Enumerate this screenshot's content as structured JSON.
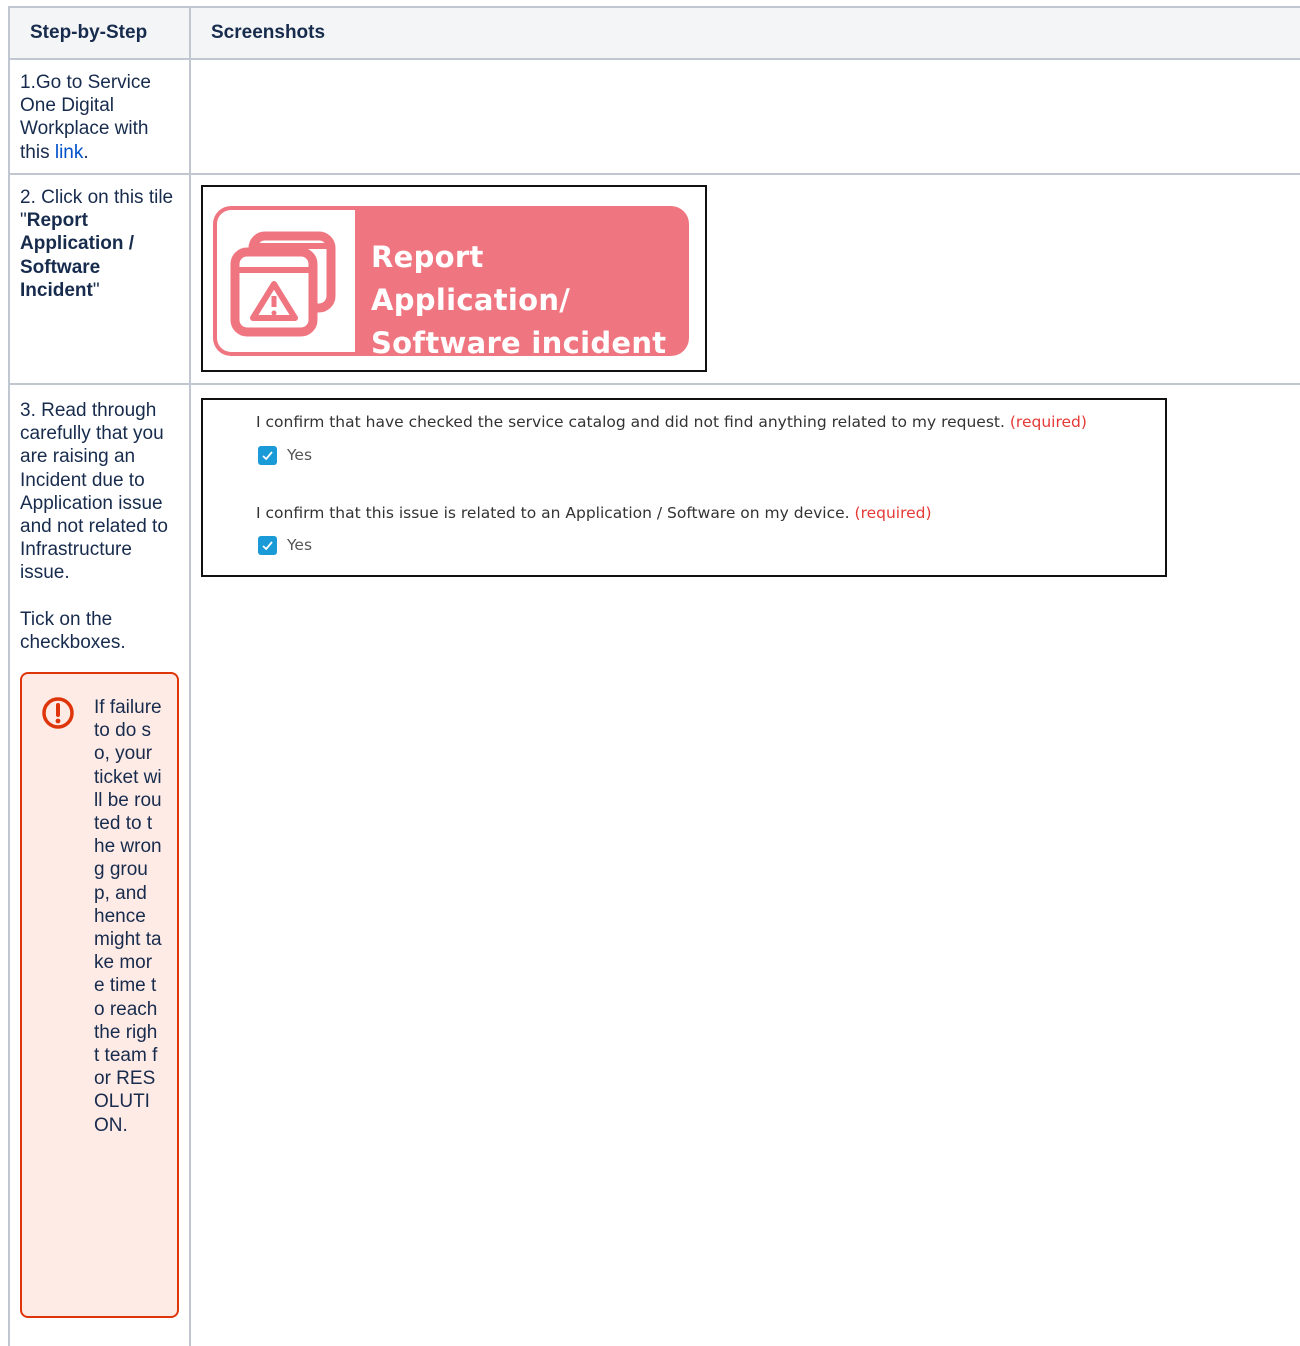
{
  "table": {
    "headers": {
      "col1": "Step-by-Step",
      "col2": "Screenshots"
    },
    "step1": {
      "text_before": "1.Go to Service One Digital Workplace with this ",
      "link_text": "link",
      "text_after": "."
    },
    "step2": {
      "prefix": "2. Click on this tile \"",
      "bold": "Report Application / Software Incident",
      "suffix": "\""
    },
    "step3": {
      "text": "3. Read through carefully that you are raising an Incident due to Application issue and not related to Infrastructure issue.",
      "instruction": "Tick on the checkboxes.",
      "warning": "If failure to do so, your ticket will be routed to the wrong group, and hence might take more time to reach the right team for RESOLUTION."
    }
  },
  "tile": {
    "line1": "Report Application/",
    "line2": "Software incident",
    "icon": "window-warning-icon",
    "color": "#ef7680"
  },
  "form": {
    "q1": "I confirm that have checked the service catalog and did not find anything related to my request.",
    "q2": "I confirm that this issue is related to an Application / Software on my device.",
    "required": "(required)",
    "option": "Yes",
    "checked_color": "#1a9ad6"
  }
}
